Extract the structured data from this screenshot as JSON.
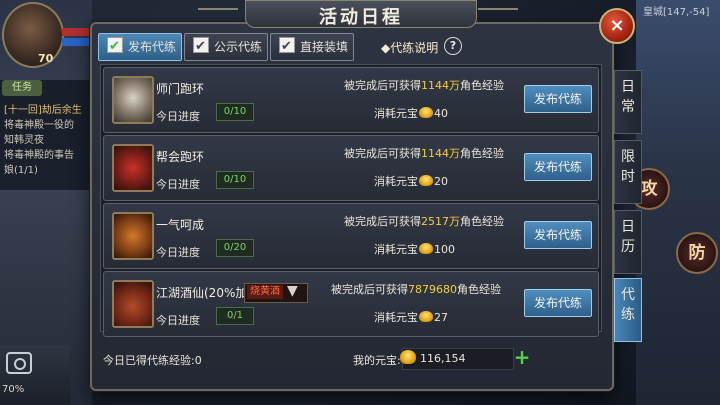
{
  "background": {
    "player_level": "70",
    "quest_tab": "任务",
    "quest_lines": [
      "[十一回]劫后余生",
      "将毒神殿一役的",
      "知韩灵夜",
      "将毒神殿的事告",
      "娘(1/1)"
    ],
    "coords": "皇城[147,-54]",
    "bottom_status": "70%",
    "skills": [
      "攻",
      "防"
    ]
  },
  "dialog": {
    "title": "活动日程",
    "close_label": "×",
    "tabs": [
      {
        "label": "发布代练",
        "active": true
      },
      {
        "label": "公示代练",
        "active": false
      },
      {
        "label": "直接装填",
        "active": false
      }
    ],
    "help_link": "◆代练说明",
    "help_icon": "?",
    "publish_label": "发布代练",
    "progress_label": "今日进度",
    "cost_label": "消耗元宝",
    "rows": [
      {
        "name": "师门跑环",
        "icon": "master-icon",
        "progress": "0/10",
        "reward_prefix": "被完成后可获得",
        "reward_value": "1144万",
        "reward_suffix": "角色经验",
        "cost": "40"
      },
      {
        "name": "帮会跑环",
        "icon": "guild-flag-icon",
        "progress": "0/10",
        "reward_prefix": "被完成后可获得",
        "reward_value": "1144万",
        "reward_suffix": "角色经验",
        "cost": "20"
      },
      {
        "name": "一气呵成",
        "icon": "dragon-icon",
        "progress": "0/20",
        "reward_prefix": "被完成后可获得",
        "reward_value": "2517万",
        "reward_suffix": "角色经验",
        "cost": "100"
      },
      {
        "name": "江湖酒仙(20%加成)",
        "icon": "wine-jar-icon",
        "progress": "0/1",
        "select_value": "烧黄酒",
        "reward_prefix": "被完成后可获得",
        "reward_value": "7879680",
        "reward_suffix": "角色经验",
        "cost": "27"
      }
    ],
    "footer": {
      "exp_today": "今日已得代练经验:0",
      "yb_label": "我的元宝:",
      "yb_value": "116,154",
      "plus": "+"
    },
    "side_tabs": [
      {
        "label": [
          "日",
          "常"
        ],
        "active": false
      },
      {
        "label": [
          "限",
          "时"
        ],
        "active": false
      },
      {
        "label": [
          "日",
          "历"
        ],
        "active": false
      },
      {
        "label": [
          "代",
          "练"
        ],
        "active": true
      }
    ]
  }
}
